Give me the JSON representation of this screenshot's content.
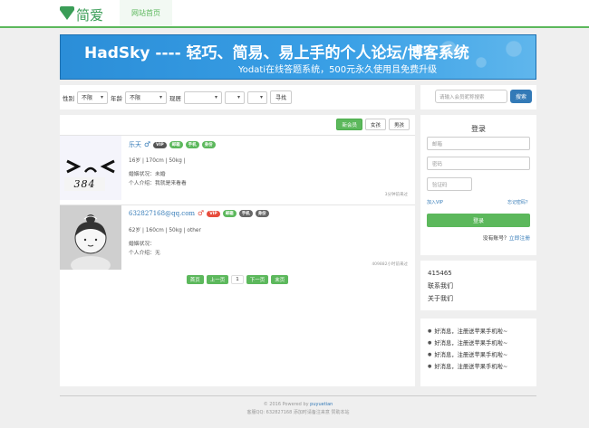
{
  "logo": {
    "text": "简爱"
  },
  "nav": {
    "home": "网站首页"
  },
  "banner": {
    "title": "HadSky ---- 轻巧、简易、易上手的个人论坛/博客系统",
    "subtitle": "Yodati在线答题系统，500元永久使用且免费升级"
  },
  "filter": {
    "gender_label": "性别",
    "gender_value": "不限",
    "age_label": "年龄",
    "age_value": "不限",
    "location_label": "现居",
    "search_button": "寻找"
  },
  "search": {
    "placeholder": "请输入会员昵称搜索",
    "button": "搜索"
  },
  "sort": {
    "new": "新会员",
    "active": "女孩",
    "male": "男孩"
  },
  "members": [
    {
      "name": "乐天",
      "sex": "♂",
      "badges": [
        "VIP",
        "邮箱",
        "手机",
        "身份"
      ],
      "detail": "16岁 | 170cm | 50kg |",
      "marital": "婚姻状况：未婚",
      "intro": "个人介绍：我就是来看看",
      "time": "3分钟前来过"
    },
    {
      "name": "632827168@qq.com",
      "sex": "♂",
      "badges": [
        "VIP",
        "邮箱",
        "手机",
        "身份"
      ],
      "detail": "62岁 | 160cm | 50kg | other",
      "marital": "婚姻状况：",
      "intro": "个人介绍：无",
      "time": "409882小时前来过"
    }
  ],
  "pager": {
    "first": "首页",
    "prev": "上一页",
    "current": "1",
    "next": "下一页",
    "last": "末页"
  },
  "login": {
    "title": "登录",
    "email_placeholder": "邮箱",
    "password_placeholder": "密码",
    "captcha_placeholder": "验证码",
    "captcha_text": "384",
    "join_vip": "加入VIP",
    "forgot": "忘记密码？",
    "submit": "登录",
    "no_account": "没有账号？",
    "register": "立即注册"
  },
  "stats": {
    "number": "415465",
    "contact": "联系我们",
    "about": "关于我们"
  },
  "news": [
    "好消息，注册送苹果手机啦~",
    "好消息，注册送苹果手机啦~",
    "好消息，注册送苹果手机啦~",
    "好消息，注册送苹果手机啦~"
  ],
  "footer": {
    "line1_prefix": "© 2016 Powered by ",
    "line1_link": "puyuetian",
    "line2": "客服QQ: 632827168  添加时请备注来意  赞助本站"
  },
  "colors": {
    "primary": "#5cb85c",
    "link": "#337ab7",
    "vip": "#e74c3c"
  }
}
